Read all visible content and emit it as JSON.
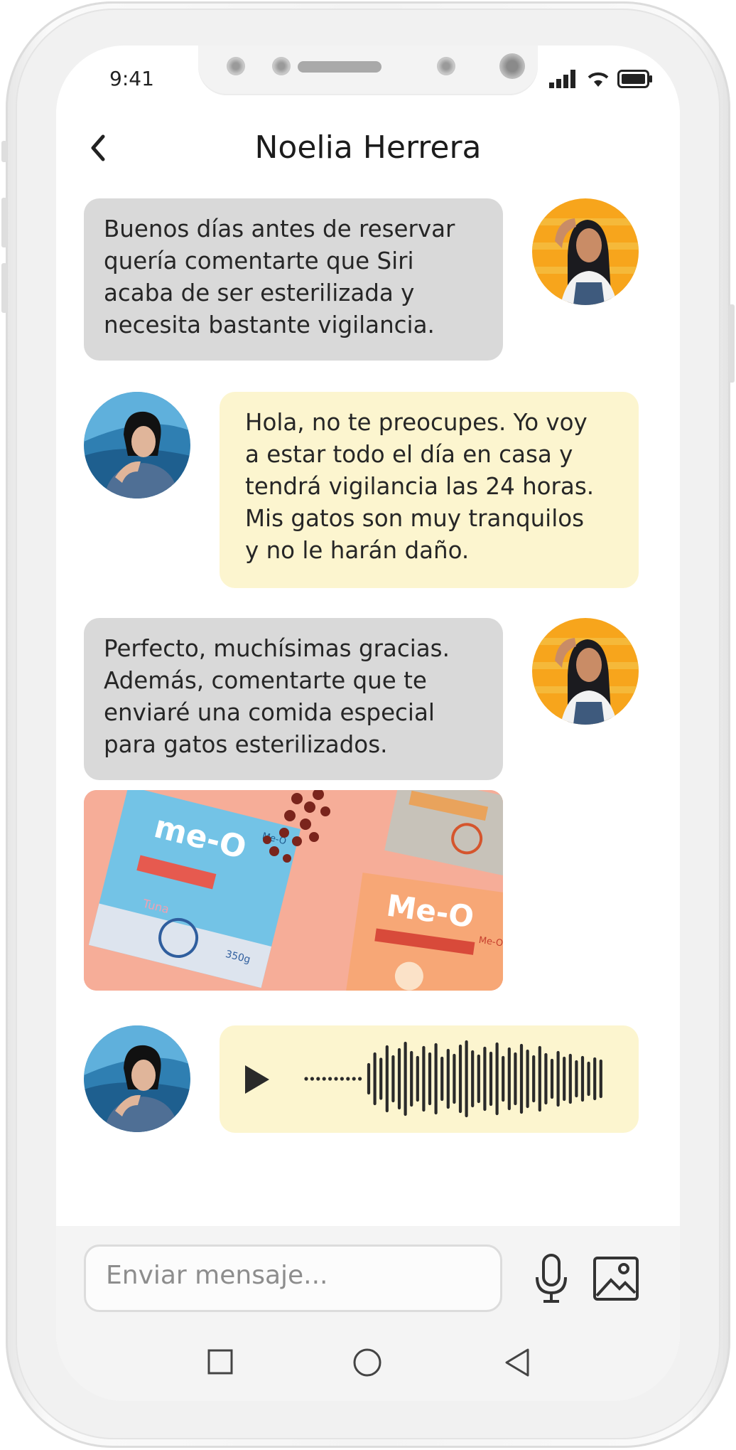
{
  "status": {
    "time": "9:41"
  },
  "header": {
    "title": "Noelia Herrera"
  },
  "messages": [
    {
      "side": "incoming",
      "text_lines": [
        "Buenos días antes de reservar",
        "quería comentarte que Siri",
        "acaba de ser esterilizada y",
        "necesita bastante vigilancia."
      ]
    },
    {
      "side": "outgoing",
      "text_lines": [
        "Hola, no te preocupes. Yo voy",
        "a estar todo el día en casa y",
        "tendrá vigilancia las 24 horas.",
        "Mis gatos son muy tranquilos",
        "y no le harán daño."
      ]
    },
    {
      "side": "incoming",
      "text_lines": [
        "Perfecto, muchísimas gracias.",
        "Además, comentarte que te",
        "enviaré una comida especial",
        "para gatos esterilizados."
      ]
    }
  ],
  "photo": {
    "brand_left": "me-O",
    "brand_small": "Me-O",
    "brand_right": "Me-O",
    "brand_right_small": "Me-O",
    "weight": "350g",
    "flavor": "Tuna"
  },
  "composer": {
    "placeholder": "Enviar mensaje..."
  },
  "icons": {
    "back": "chevron-left-icon",
    "mic": "microphone-icon",
    "image": "image-icon",
    "play": "play-icon",
    "nav": [
      "square-icon",
      "circle-icon",
      "triangle-back-icon"
    ]
  },
  "colors": {
    "incoming_bubble": "#d9d9d9",
    "outgoing_bubble": "#fcf5cf",
    "text": "#262626"
  }
}
